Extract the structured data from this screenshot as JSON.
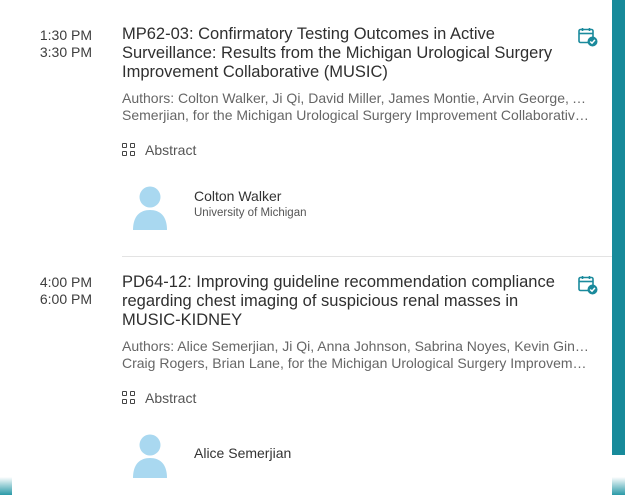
{
  "sessions": [
    {
      "time_start": "1:30 PM",
      "time_end": "3:30 PM",
      "title": "MP62-03: Confirmatory Testing Outcomes in Active Surveillance: Results from the Michigan Urological Surgery Improvement Collaborative (MUSIC)",
      "authors_line1": "Authors: Colton Walker, Ji Qi, David Miller, James Montie, Arvin George, Alice",
      "authors_line2": "Semerjian, for the Michigan Urological Surgery Improvement Collaborative…",
      "abstract_label": "Abstract",
      "speaker_name": "Colton Walker",
      "speaker_affiliation": "University of Michigan",
      "calendar_icon": "calendar-check-icon"
    },
    {
      "time_start": "4:00 PM",
      "time_end": "6:00 PM",
      "title": "PD64-12: Improving guideline recommendation compliance regarding chest imaging of suspicious renal masses in MUSIC-KIDNEY",
      "authors_line1": "Authors: Alice Semerjian, Ji Qi, Anna Johnson, Sabrina Noyes, Kevin Ginsburg,",
      "authors_line2": "Craig Rogers, Brian Lane, for the Michigan Urological Surgery Improvement…",
      "abstract_label": "Abstract",
      "speaker_name": "Alice Semerjian",
      "speaker_affiliation": "",
      "calendar_icon": "calendar-check-icon"
    }
  ],
  "colors": {
    "accent": "#178a9a",
    "avatar": "#a9d8f0",
    "calendar": "#1a8a9c"
  }
}
